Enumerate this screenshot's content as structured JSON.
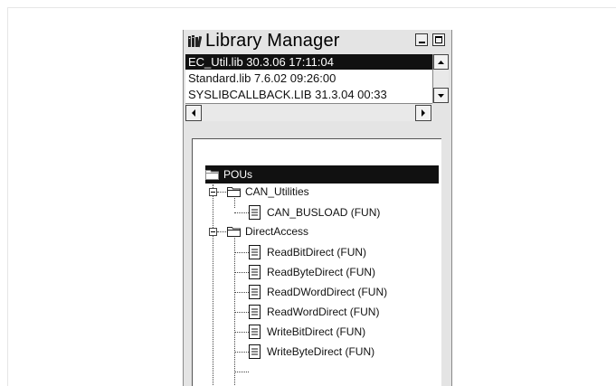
{
  "window": {
    "title": "Library Manager",
    "icon": "library-manager-icon",
    "minimize_icon": "minimize-icon",
    "maximize_icon": "maximize-icon"
  },
  "libraries": [
    {
      "label": "EC_Util.lib 30.3.06 17:11:04",
      "selected": true
    },
    {
      "label": "Standard.lib 7.6.02 09:26:00",
      "selected": false
    },
    {
      "label": "SYSLIBCALLBACK.LIB 31.3.04 00:33",
      "selected": false
    }
  ],
  "tree": {
    "root": {
      "label": "POUs",
      "icon": "folder-open-icon",
      "selected": true
    },
    "groups": [
      {
        "label": "CAN_Utilities",
        "icon": "folder-open-icon",
        "items": [
          {
            "label": "CAN_BUSLOAD (FUN)",
            "icon": "document-icon"
          }
        ]
      },
      {
        "label": "DirectAccess",
        "icon": "folder-open-icon",
        "items": [
          {
            "label": "ReadBitDirect (FUN)",
            "icon": "document-icon"
          },
          {
            "label": "ReadByteDirect (FUN)",
            "icon": "document-icon"
          },
          {
            "label": "ReadDWordDirect (FUN)",
            "icon": "document-icon"
          },
          {
            "label": "ReadWordDirect (FUN)",
            "icon": "document-icon"
          },
          {
            "label": "WriteBitDirect (FUN)",
            "icon": "document-icon"
          },
          {
            "label": "WriteByteDirect (FUN)",
            "icon": "document-icon"
          }
        ]
      }
    ]
  }
}
